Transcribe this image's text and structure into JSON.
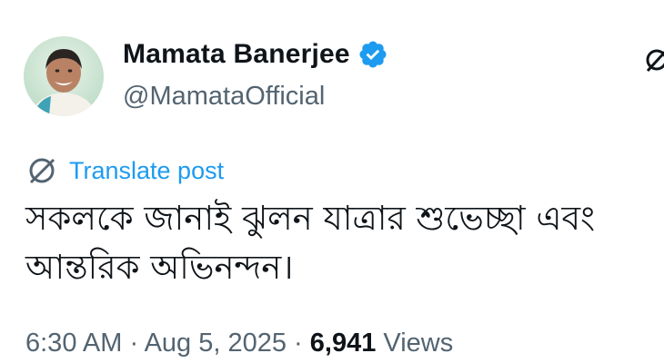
{
  "author": {
    "display_name": "Mamata Banerjee",
    "handle": "@MamataOfficial",
    "verified_icon": "verified-badge-icon"
  },
  "translate": {
    "label": "Translate post",
    "icon": "globe-translate-icon"
  },
  "post": {
    "text": "সকলকে জানাই ঝুলন যাত্রার শুভেচ্ছা এবং আন্তরিক অভিনন্দন।"
  },
  "meta": {
    "time": "6:30 AM",
    "separator": " · ",
    "date": "Aug 5, 2025",
    "views_count": "6,941",
    "views_label": "Views"
  },
  "colors": {
    "accent": "#1d9bf0",
    "secondary_text": "#536471",
    "primary_text": "#0f1419"
  }
}
